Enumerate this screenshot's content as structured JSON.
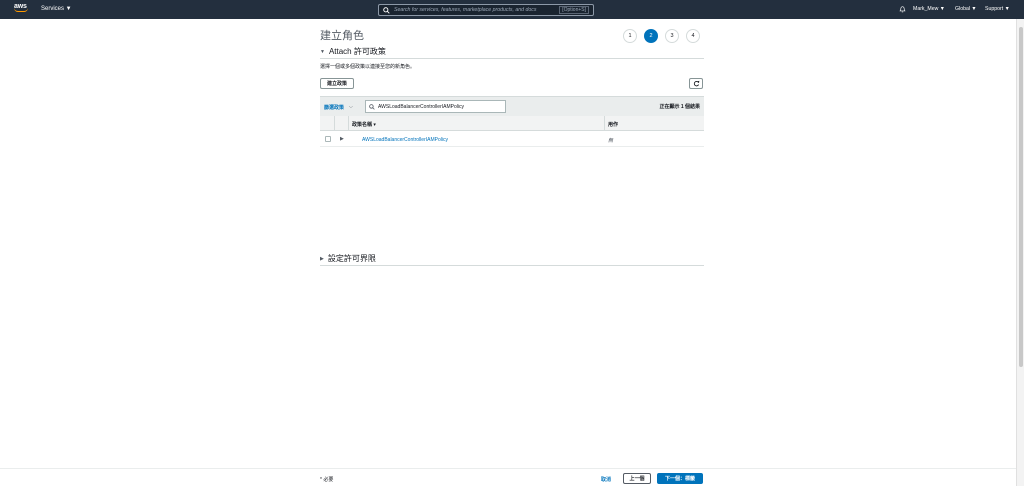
{
  "nav": {
    "logo_text": "aws",
    "services_label": "Services ▼",
    "search_placeholder": "Search for services, features, marketplace products, and docs",
    "search_shortcut": "[Option+S]",
    "user": "Mark_Mew ▼",
    "region": "Global ▼",
    "support": "Support ▼"
  },
  "page": {
    "title": "建立角色",
    "steps": [
      "1",
      "2",
      "3",
      "4"
    ],
    "active_step": 2
  },
  "attach_section": {
    "heading": "Attach 許可政策",
    "description": "選擇一個或多個政策以連接至您的新角色。",
    "create_policy_button": "建立政策"
  },
  "table": {
    "filter_label": "篩選政策",
    "filter_caret": "⌵",
    "search_value": "AWSLoadBalancerControllerIAMPolicy",
    "showing_text": "正在顯示 1 個結果",
    "columns": {
      "name": "政策名稱 ▾",
      "usage": "用作"
    },
    "rows": [
      {
        "name": "AWSLoadBalancerControllerIAMPolicy",
        "usage": "無"
      }
    ]
  },
  "boundary_section": {
    "heading": "設定許可界限"
  },
  "footer": {
    "required": "* 必要",
    "cancel": "取消",
    "previous": "上一個",
    "next": "下一個：標籤"
  },
  "colors": {
    "nav_bg": "#232f3e",
    "accent": "#0073bb",
    "aws_orange": "#ff9900"
  }
}
